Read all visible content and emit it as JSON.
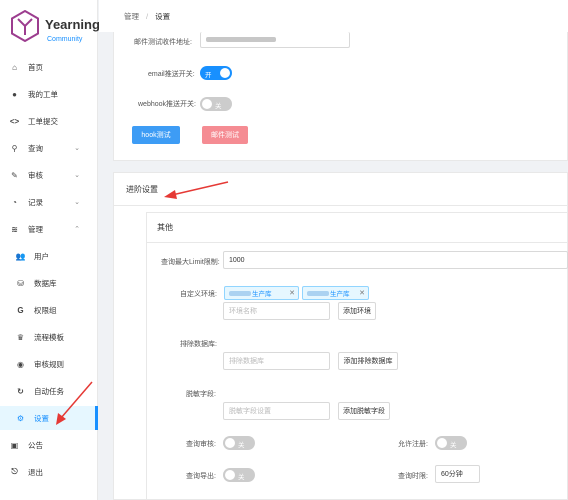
{
  "brand": {
    "title": "Yearning",
    "subtitle": "Community"
  },
  "sidebar": {
    "items": [
      {
        "label": "首页",
        "icon": "home-icon"
      },
      {
        "label": "我的工单",
        "icon": "user-icon"
      },
      {
        "label": "工单提交",
        "icon": "code-icon"
      },
      {
        "label": "查询",
        "icon": "search-icon"
      },
      {
        "label": "审核",
        "icon": "edit-icon"
      },
      {
        "label": "记录",
        "icon": "pie-chart-icon"
      },
      {
        "label": "管理",
        "icon": "layers-icon"
      },
      {
        "label": "用户",
        "icon": "team-icon"
      },
      {
        "label": "数据库",
        "icon": "database-icon"
      },
      {
        "label": "权限组",
        "icon": "google-icon"
      },
      {
        "label": "流程模板",
        "icon": "trophy-icon"
      },
      {
        "label": "审核规则",
        "icon": "dashboard-icon"
      },
      {
        "label": "自动任务",
        "icon": "sync-icon"
      },
      {
        "label": "设置",
        "icon": "gear-icon"
      },
      {
        "label": "公告",
        "icon": "clipboard-icon"
      },
      {
        "label": "退出",
        "icon": "logout-icon"
      }
    ]
  },
  "breadcrumb": {
    "parent": "管理",
    "separator": "/",
    "current": "设置"
  },
  "mail": {
    "receiver_label": "邮件测试收件地址:",
    "email_push_label": "email推送开关:",
    "email_push_state": "开",
    "webhook_push_label": "webhook推送开关:",
    "webhook_push_state": "关",
    "hook_test_label": "hook测试",
    "mail_test_label": "邮件测试"
  },
  "advanced": {
    "title": "进阶设置",
    "other_title": "其他",
    "query_limit_label": "查询最大Limit限制:",
    "query_limit_value": "1000",
    "env_label": "自定义环境:",
    "env_tags": [
      "生产库",
      "生产库"
    ],
    "env_placeholder": "环境名称",
    "add_env_label": "添加环境",
    "exclude_db_label": "排除数据库:",
    "exclude_db_placeholder": "排除数据库",
    "add_exclude_db_label": "添加排除数据库",
    "mask_label": "脱敏字段:",
    "mask_placeholder": "脱敏字段设置",
    "add_mask_label": "添加脱敏字段",
    "query_audit_label": "查询审核:",
    "query_audit_state": "关",
    "allow_register_label": "允许注册:",
    "allow_register_state": "关",
    "query_export_label": "查询导出:",
    "query_export_state": "关",
    "query_timeout_label": "查询时限:",
    "query_timeout_value": "60分钟"
  },
  "colors": {
    "accent": "#1890ff",
    "annotation": "#e53935"
  }
}
